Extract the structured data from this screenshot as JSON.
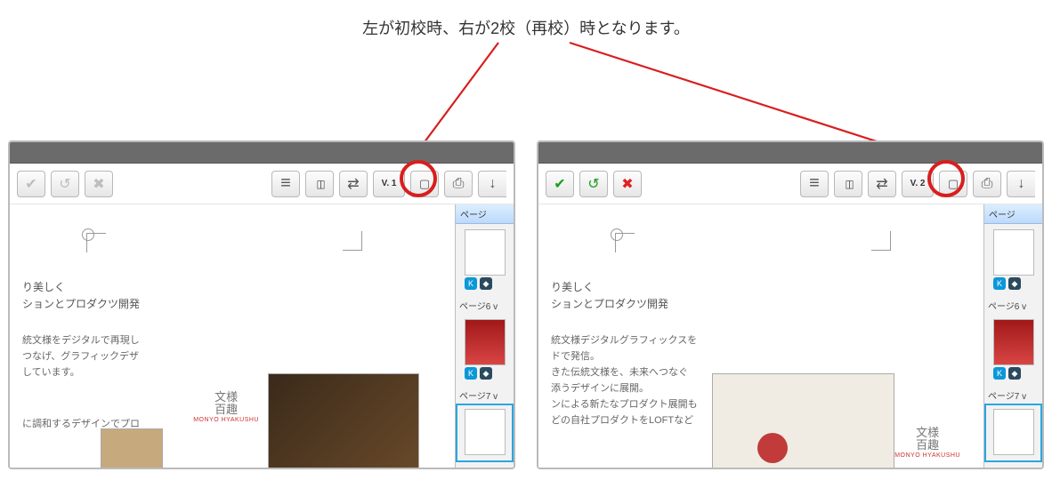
{
  "caption": "左が初校時、右が2校（再校）時となります。",
  "highlight_color": "#d81e1e",
  "left_panel": {
    "version_label": "V. 1",
    "approve_enabled": false,
    "doc": {
      "line1": "り美しく",
      "line2": "ションとプロダクツ開発",
      "block3_l1": "統文様をデジタルで再現し",
      "block3_l2": "つなげ、グラフィックデザ",
      "block3_l3": "しています。",
      "block3_l4": "に調和するデザインでプロ",
      "logo_top": "文様",
      "logo_mid": "百趣",
      "logo_sub": "MONYO HYAKUSHU"
    },
    "sidebar": {
      "header": "ページ",
      "items": [
        {
          "label": "",
          "chips": [
            "K",
            ""
          ],
          "red": false,
          "active": false
        },
        {
          "label": "ページ6 v",
          "chips": [
            "K",
            ""
          ],
          "red": true,
          "active": false
        },
        {
          "label": "ページ7 v",
          "chips": [],
          "red": false,
          "active": true
        }
      ]
    }
  },
  "right_panel": {
    "version_label": "V. 2",
    "approve_enabled": true,
    "doc": {
      "line1": "り美しく",
      "line2": "ションとプロダクツ開発",
      "block3_l1": "統文様デジタルグラフィックスを",
      "block3_l2": "ドで発信。",
      "block3_l3": "きた伝統文様を、未来へつなぐ",
      "block3_l4": "添うデザインに展開。",
      "block3_l5": "ンによる新たなプロダクト展開も",
      "block3_l6": "どの自社プロダクトをLOFTなど",
      "logo_top": "文様",
      "logo_mid": "百趣",
      "logo_sub": "MONYO HYAKUSHU"
    },
    "sidebar": {
      "header": "ページ",
      "items": [
        {
          "label": "",
          "chips": [
            "K",
            ""
          ],
          "red": false,
          "active": false
        },
        {
          "label": "ページ6 v",
          "chips": [
            "K",
            ""
          ],
          "red": true,
          "active": false
        },
        {
          "label": "ページ7 v",
          "chips": [],
          "red": false,
          "active": true
        }
      ]
    }
  }
}
